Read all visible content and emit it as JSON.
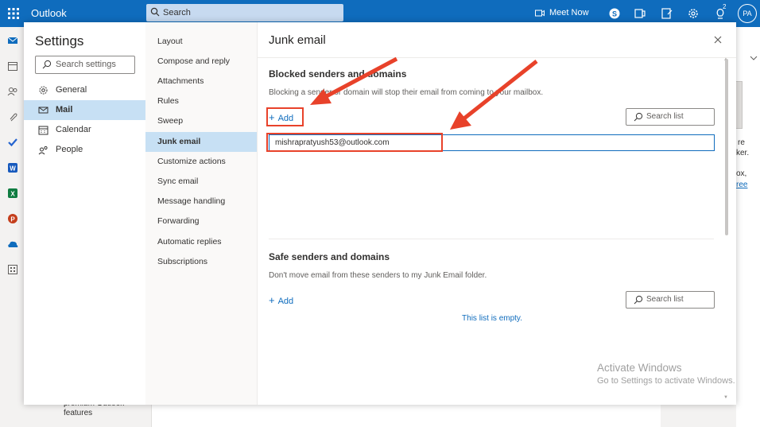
{
  "app": {
    "title": "Outlook",
    "search_placeholder": "Search",
    "meet_now": "Meet Now",
    "avatar": "PA",
    "badge": "2"
  },
  "background": {
    "premium_text_1": "premium Outlook",
    "premium_text_2": "features",
    "right_fragments": [
      "re",
      "ker.",
      "ox,",
      "ree"
    ]
  },
  "settings": {
    "title": "Settings",
    "search_placeholder": "Search settings",
    "categories": [
      {
        "label": "General",
        "icon": "gear-icon"
      },
      {
        "label": "Mail",
        "icon": "mail-icon",
        "active": true
      },
      {
        "label": "Calendar",
        "icon": "calendar-icon"
      },
      {
        "label": "People",
        "icon": "people-icon"
      }
    ],
    "mail_items": [
      "Layout",
      "Compose and reply",
      "Attachments",
      "Rules",
      "Sweep",
      "Junk email",
      "Customize actions",
      "Sync email",
      "Message handling",
      "Forwarding",
      "Automatic replies",
      "Subscriptions"
    ],
    "active_mail_item": "Junk email"
  },
  "junk": {
    "title": "Junk email",
    "blocked": {
      "title": "Blocked senders and domains",
      "desc": "Blocking a sender or domain will stop their email from coming to your mailbox.",
      "add_label": "Add",
      "search_placeholder": "Search list",
      "input_value": "mishrapratyush53@outlook.com"
    },
    "safe": {
      "title": "Safe senders and domains",
      "desc": "Don't move email from these senders to my Junk Email folder.",
      "add_label": "Add",
      "search_placeholder": "Search list",
      "empty_text": "This list is empty."
    }
  },
  "watermark": {
    "line1": "Activate Windows",
    "line2": "Go to Settings to activate Windows."
  },
  "colors": {
    "brand": "#0f6cbd",
    "highlight": "#e8422a",
    "active_bg": "#c7e0f4"
  }
}
